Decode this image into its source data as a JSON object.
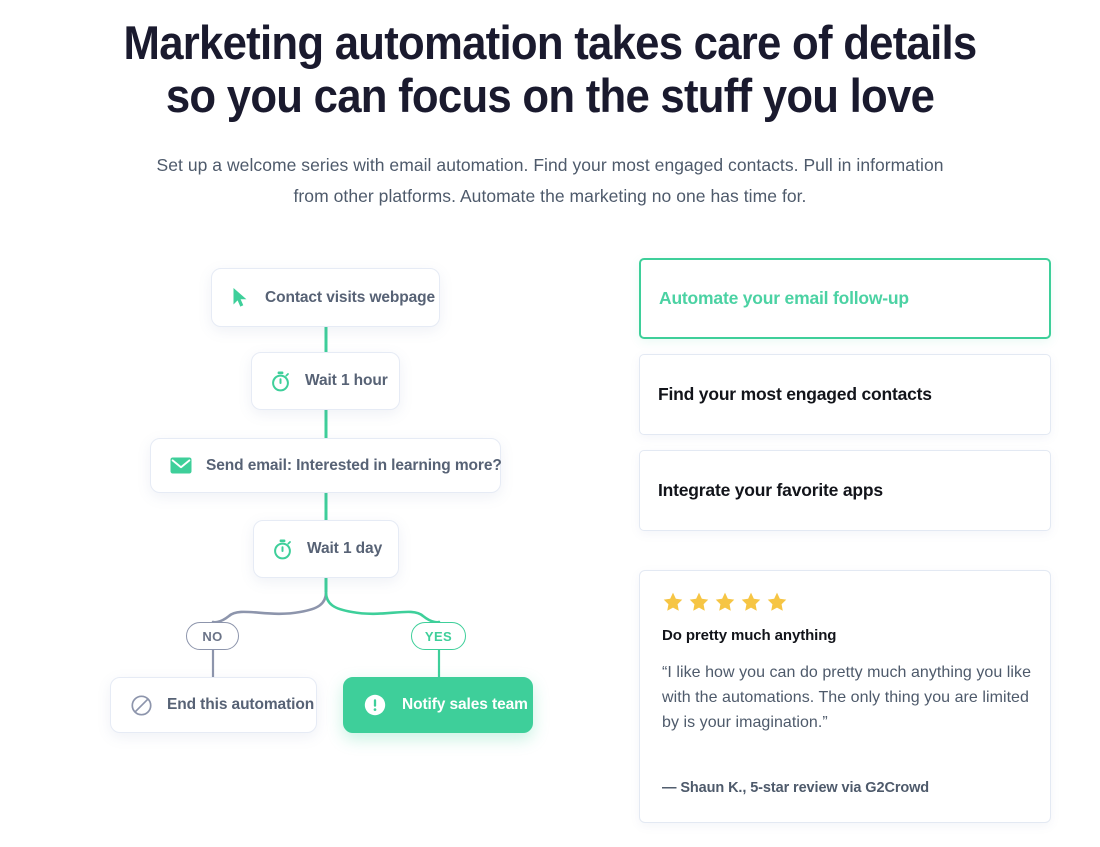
{
  "hero": {
    "heading_line1": "Marketing automation takes care of details",
    "heading_line2": "so you can focus on the stuff you love",
    "subtitle_line1": "Set up a welcome series with email automation. Find your most engaged contacts. Pull in",
    "subtitle_line2": "information from other platforms. Automate the marketing no one has time for."
  },
  "colors": {
    "accent_green": "#3ECF9A",
    "accent_green_text": "#4BD2A3",
    "star_yellow": "#F6C544",
    "heading_dark": "#1a1a2e",
    "body_gray": "#4e5a6b",
    "node_gray": "#576275",
    "connector_gray": "#8d95ac",
    "card_border": "#e3e9f3"
  },
  "flow": {
    "nodes": [
      {
        "id": "visit",
        "label": "Contact visits webpage",
        "icon": "cursor-icon"
      },
      {
        "id": "wait1h",
        "label": "Wait 1 hour",
        "icon": "stopwatch-icon"
      },
      {
        "id": "email",
        "label": "Send email: Interested in learning more?",
        "icon": "envelope-icon"
      },
      {
        "id": "wait1d",
        "label": "Wait 1 day",
        "icon": "stopwatch-icon"
      },
      {
        "id": "end",
        "label": "End this automation",
        "icon": "no-entry-icon"
      },
      {
        "id": "notify",
        "label": "Notify sales team",
        "icon": "exclamation-circle-icon"
      }
    ],
    "branches": [
      {
        "id": "no",
        "label": "NO"
      },
      {
        "id": "yes",
        "label": "YES"
      }
    ]
  },
  "accordion": {
    "items": [
      {
        "label": "Automate your email follow-up",
        "active": true
      },
      {
        "label": "Find your most engaged contacts",
        "active": false
      },
      {
        "label": "Integrate your favorite apps",
        "active": false
      }
    ]
  },
  "review": {
    "rating": 5,
    "title": "Do pretty much anything",
    "quote_line1": "“I like how you can do pretty much anything you like",
    "quote_line2": "with the automations. The only thing you are",
    "quote_line3": "limited by is your imagination.”",
    "attribution": "— Shaun K., 5-star review via G2Crowd"
  }
}
